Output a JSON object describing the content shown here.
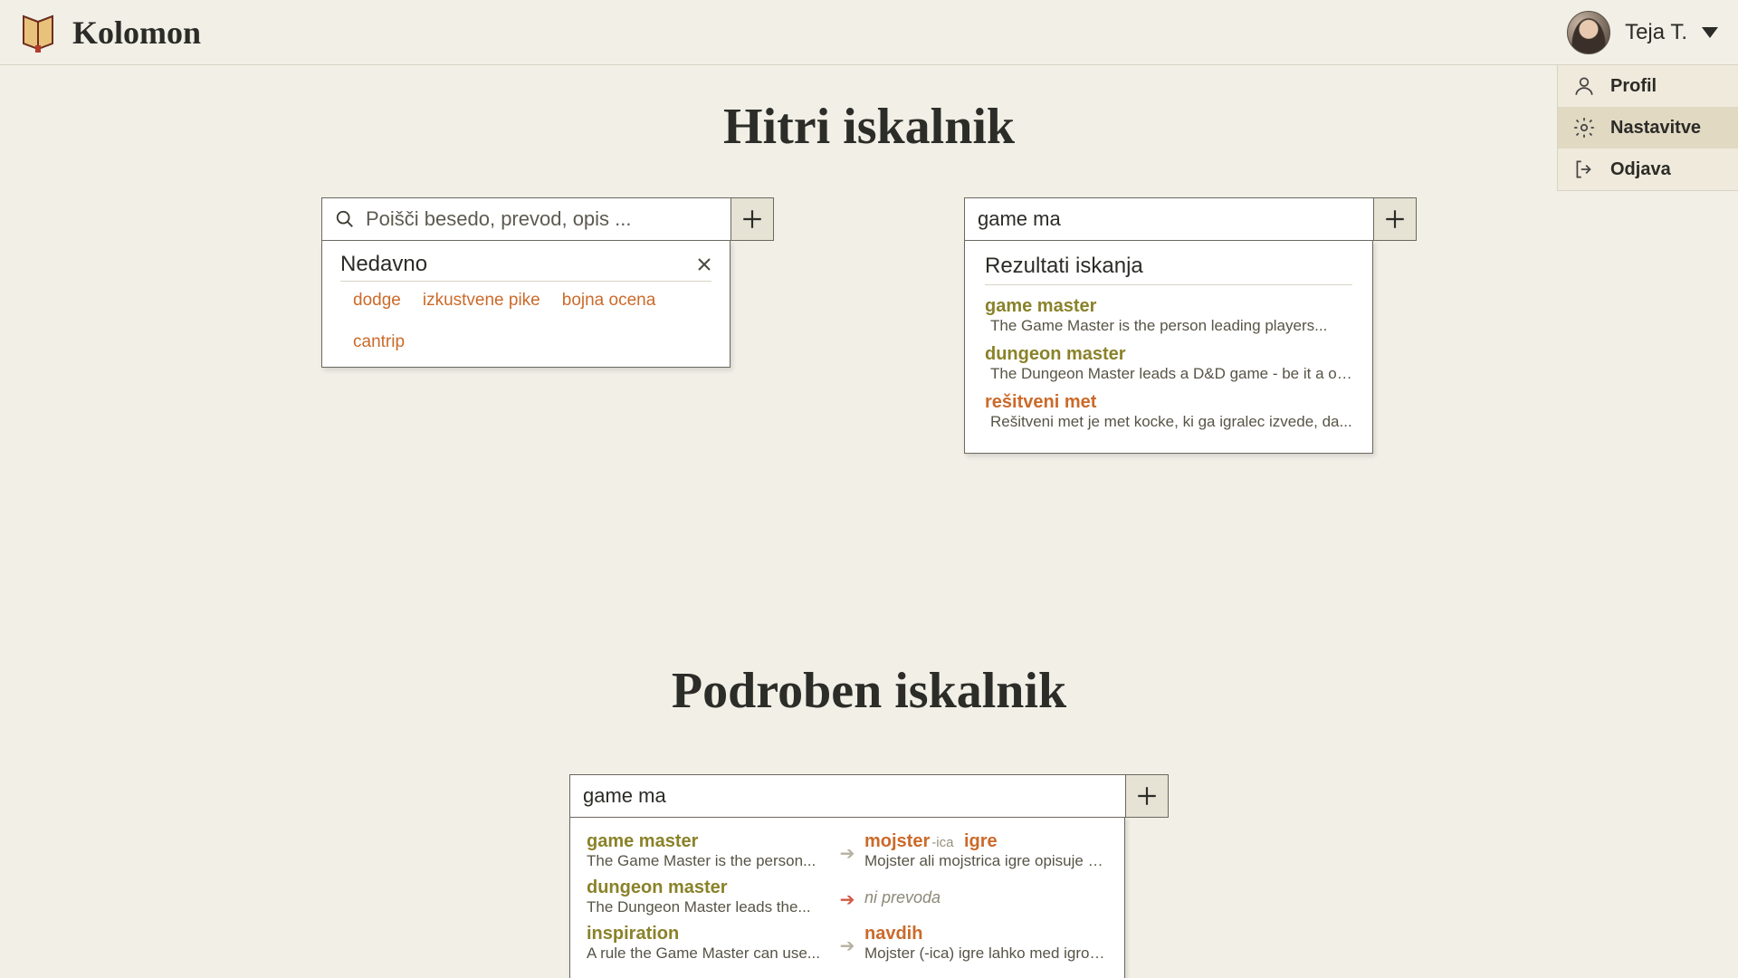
{
  "brand": {
    "name": "Kolomon"
  },
  "user": {
    "display_name": "Teja T."
  },
  "user_menu": {
    "profile": "Profil",
    "settings": "Nastavitve",
    "logout": "Odjava"
  },
  "quick_search": {
    "title": "Hitri iskalnik",
    "left": {
      "placeholder": "Poišči besedo, prevod, opis ...",
      "recent_heading": "Nedavno",
      "recent_terms": [
        "dodge",
        "izkustvene pike",
        "bojna ocena",
        "cantrip"
      ]
    },
    "right": {
      "value": "game ma",
      "results_heading": "Rezultati iskanja",
      "results": [
        {
          "term": "game master",
          "kind": "olive",
          "desc": "The Game Master is the person leading players..."
        },
        {
          "term": "dungeon master",
          "kind": "olive",
          "desc": "The Dungeon Master leads a D&D game - be it a one-shot, ..."
        },
        {
          "term": "rešitveni met",
          "kind": "orange",
          "desc": "Rešitveni met je met kocke, ki ga igralec izvede, da..."
        }
      ]
    }
  },
  "detailed_search": {
    "title": "Podroben iskalnik",
    "value": "game ma",
    "no_translation_label": "ni prevoda",
    "pairs": [
      {
        "src_term": "game master",
        "src_desc": "The Game Master is the person...",
        "arrow": "grey",
        "dst_term": "mojster",
        "dst_suffix": "-ica",
        "dst_term2": "igre",
        "dst_desc": "Mojster ali mojstrica igre opisuje svet, v..."
      },
      {
        "src_term": "dungeon master",
        "src_desc": "The Dungeon Master leads the...",
        "arrow": "red",
        "dst_term": null
      },
      {
        "src_term": "inspiration",
        "src_desc": "A rule the Game Master can use...",
        "arrow": "grey",
        "dst_term": "navdih",
        "dst_desc": "Mojster (-ica) igre lahko med igro igralcu..."
      }
    ]
  }
}
